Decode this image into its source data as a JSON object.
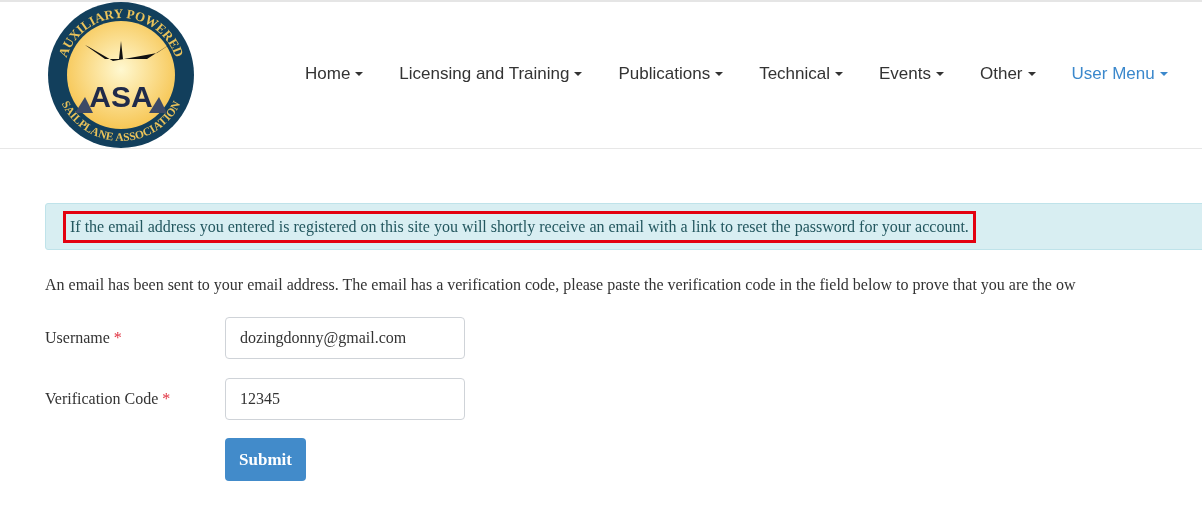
{
  "logo": {
    "top_text": "AUXILIARY POWERED",
    "bottom_text": "SAILPLANE ASSOCIATION",
    "initials": "ASA"
  },
  "nav": [
    {
      "label": "Home",
      "highlighted": false
    },
    {
      "label": "Licensing and Training",
      "highlighted": false
    },
    {
      "label": "Publications",
      "highlighted": false
    },
    {
      "label": "Technical",
      "highlighted": false
    },
    {
      "label": "Events",
      "highlighted": false
    },
    {
      "label": "Other",
      "highlighted": false
    },
    {
      "label": "User Menu",
      "highlighted": true
    }
  ],
  "alert": {
    "text": "If the email address you entered is registered on this site you will shortly receive an email with a link to reset the password for your account.",
    "outlined": true
  },
  "intro": "An email has been sent to your email address. The email has a verification code, please paste the verification code in the field below to prove that you are the ow",
  "form": {
    "fields": [
      {
        "label": "Username",
        "required_mark": "*",
        "value": "dozingdonny@gmail.com"
      },
      {
        "label": "Verification Code",
        "required_mark": "*",
        "value": "12345"
      }
    ],
    "submit": "Submit"
  }
}
